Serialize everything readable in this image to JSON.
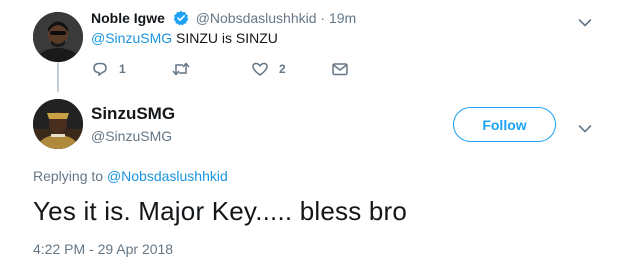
{
  "parent_tweet": {
    "display_name": "Noble Igwe",
    "handle": "@Nobsdaslushhkid",
    "separator": "·",
    "time": "19m",
    "mention": "@SinzuSMG",
    "text": " SINZU is SINZU",
    "actions": {
      "reply_icon": "reply-icon",
      "reply_count": "1",
      "retweet_icon": "retweet-icon",
      "retweet_count": "",
      "like_icon": "heart-icon",
      "like_count": "2",
      "dm_icon": "envelope-icon"
    }
  },
  "main_tweet": {
    "display_name": "SinzuSMG",
    "handle": "@SinzuSMG",
    "follow_label": "Follow",
    "replying_prefix": "Replying to ",
    "replying_to": "@Nobsdaslushhkid",
    "text": "Yes it is. Major Key..... bless bro",
    "timestamp": "4:22 PM - 29 Apr 2018"
  },
  "colors": {
    "accent": "#1da1f2",
    "link": "#1b95e0",
    "secondary_text": "#657786",
    "primary_text": "#14171a",
    "thread_line": "#c4cfd6"
  }
}
